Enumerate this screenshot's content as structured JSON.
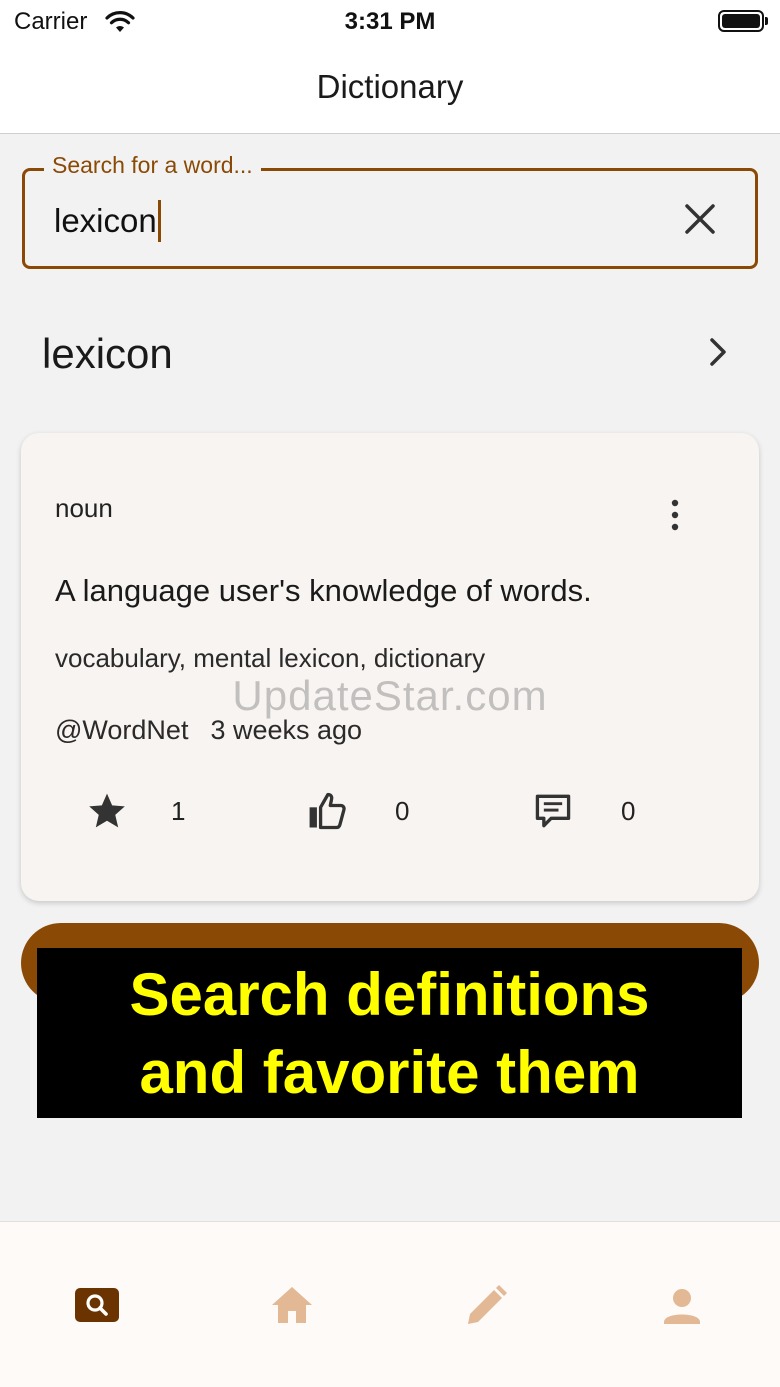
{
  "status_bar": {
    "carrier": "Carrier",
    "time": "3:31 PM"
  },
  "nav": {
    "title": "Dictionary"
  },
  "search": {
    "label": "Search for a word...",
    "value": "lexicon"
  },
  "result": {
    "word": "lexicon"
  },
  "card": {
    "part_of_speech": "noun",
    "definition": "A language user's knowledge of words.",
    "synonyms": "vocabulary, mental lexicon, dictionary",
    "source": "@WordNet",
    "age": "3 weeks ago",
    "favorites": "1",
    "likes": "0",
    "comments": "0"
  },
  "watermark": "UpdateStar.com",
  "banner": {
    "line1": "Search definitions",
    "line2": "and favorite them"
  },
  "tabs": [
    {
      "icon": "search-icon",
      "active": true
    },
    {
      "icon": "home-icon",
      "active": false
    },
    {
      "icon": "pencil-icon",
      "active": false
    },
    {
      "icon": "person-icon",
      "active": false
    }
  ],
  "colors": {
    "accent": "#8a4a06",
    "tab_inactive": "#e2b895",
    "banner_text": "#ffff00",
    "banner_bg": "#000000"
  }
}
